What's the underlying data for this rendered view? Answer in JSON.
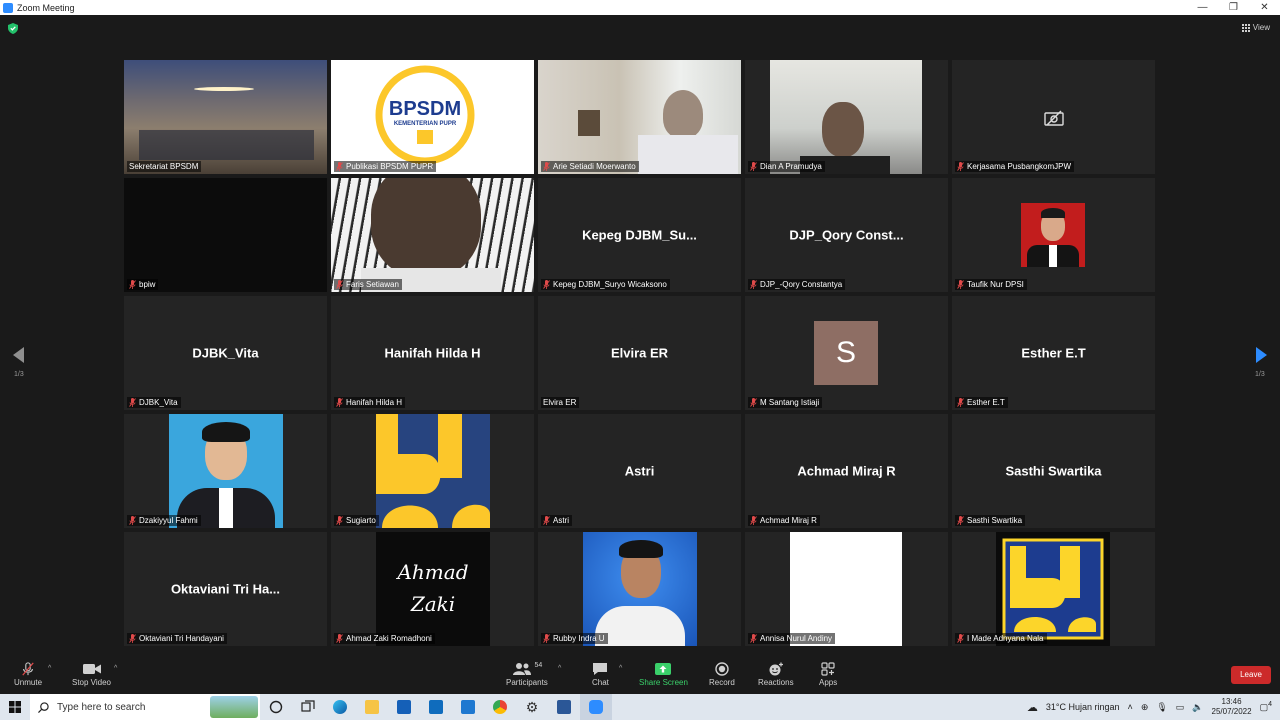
{
  "window": {
    "title": "Zoom Meeting",
    "controls": [
      "—",
      "❐",
      "✕"
    ]
  },
  "header": {
    "view_label": "View"
  },
  "pager": {
    "left": "1/3",
    "right": "1/3"
  },
  "tiles": [
    {
      "name": "Sekretariat BPSDM",
      "big": "",
      "muted": false,
      "active": true
    },
    {
      "name": "Publikasi BPSDM PUPR",
      "big": "",
      "muted": true
    },
    {
      "name": "Arie Setiadi Moerwanto",
      "big": "",
      "muted": true
    },
    {
      "name": "Dian A Pramudya",
      "big": "",
      "muted": true
    },
    {
      "name": "Kerjasama PusbangkomJPW",
      "big": "",
      "muted": true
    },
    {
      "name": "bpiw",
      "big": "",
      "muted": true
    },
    {
      "name": "Faris Setiawan",
      "big": "",
      "muted": true
    },
    {
      "name": "Kepeg DJBM_Suryo Wicaksono",
      "big": "Kepeg  DJBM_Su...",
      "muted": true
    },
    {
      "name": "DJP_-Qory Constantya",
      "big": "DJP_Qory  Const...",
      "muted": true
    },
    {
      "name": "Taufik Nur DPSI",
      "big": "",
      "muted": true
    },
    {
      "name": "DJBK_Vita",
      "big": "DJBK_Vita",
      "muted": true
    },
    {
      "name": "Hanifah Hilda H",
      "big": "Hanifah  Hilda  H",
      "muted": true
    },
    {
      "name": "Elvira ER",
      "big": "Elvira  ER",
      "muted": false
    },
    {
      "name": "M Santang Istiaji",
      "big": "",
      "muted": true
    },
    {
      "name": "Esther E.T",
      "big": "Esther  E.T",
      "muted": true
    },
    {
      "name": "Dzakiyyul Fahmi",
      "big": "",
      "muted": true
    },
    {
      "name": "Sugiarto",
      "big": "",
      "muted": true
    },
    {
      "name": "Astri",
      "big": "Astri",
      "muted": true
    },
    {
      "name": "Achmad Miraj R",
      "big": "Achmad  Miraj  R",
      "muted": true
    },
    {
      "name": "Sasthi Swartika",
      "big": "Sasthi  Swartika",
      "muted": true
    },
    {
      "name": "Oktaviani Tri Handayani",
      "big": "Oktaviani  Tri  Ha...",
      "muted": true
    },
    {
      "name": "Ahmad Zaki Romadhoni",
      "big": "",
      "muted": true
    },
    {
      "name": "Rubby Indra U",
      "big": "",
      "muted": true
    },
    {
      "name": "Annisa Nurul Andiny",
      "big": "",
      "muted": true
    },
    {
      "name": "I Made Adnyana Nala",
      "big": "",
      "muted": true
    }
  ],
  "logo_text": {
    "bpsdm": "BPSDM",
    "bpsdm_sub": "KEMENTERIAN PUPR",
    "avatar_letter": "S",
    "zaki_1": "Ahmad",
    "zaki_2": "Zaki"
  },
  "toolbar": {
    "unmute": "Unmute",
    "stop_video": "Stop Video",
    "participants": "Participants",
    "participants_count": "54",
    "chat": "Chat",
    "share_screen": "Share Screen",
    "record": "Record",
    "reactions": "Reactions",
    "apps": "Apps",
    "leave": "Leave"
  },
  "taskbar": {
    "search_placeholder": "Type here to search",
    "weather": "31°C  Hujan ringan",
    "time": "13:46",
    "date": "25/07/2022",
    "notif_count": "4"
  },
  "colors": {
    "active_border": "#e9e37a",
    "leave": "#cc2a2a",
    "share": "#3ad06a",
    "pupr_yellow": "#fcc72a",
    "pupr_blue": "#1d3c8f"
  }
}
